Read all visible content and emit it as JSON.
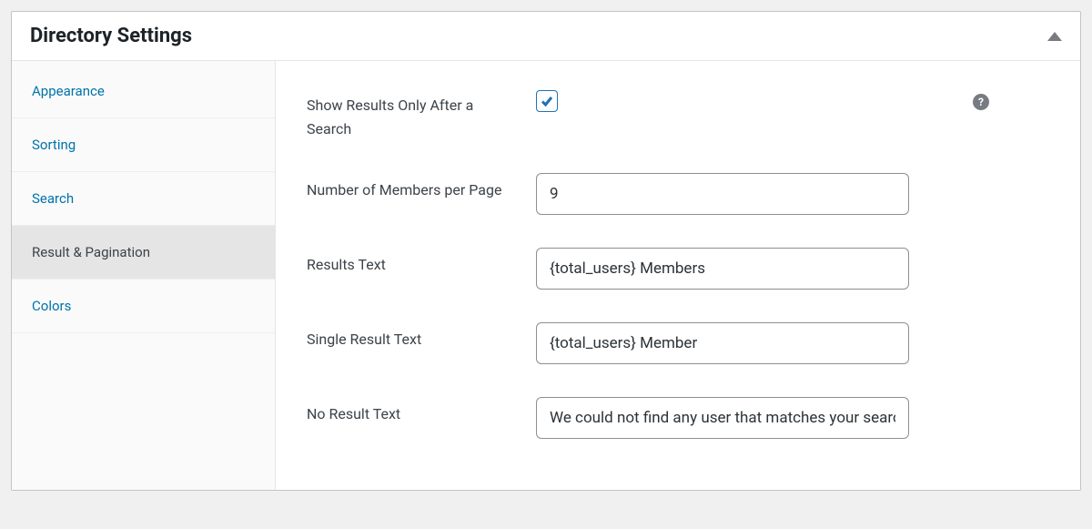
{
  "panel": {
    "title": "Directory Settings"
  },
  "sidebar": {
    "items": [
      {
        "label": "Appearance"
      },
      {
        "label": "Sorting"
      },
      {
        "label": "Search"
      },
      {
        "label": "Result & Pagination"
      },
      {
        "label": "Colors"
      }
    ],
    "active_index": 3
  },
  "form": {
    "show_results_after_search": {
      "label": "Show Results Only After a Search",
      "checked": true
    },
    "members_per_page": {
      "label": "Number of Members per Page",
      "value": "9"
    },
    "results_text": {
      "label": "Results Text",
      "value": "{total_users} Members"
    },
    "single_result_text": {
      "label": "Single Result Text",
      "value": "{total_users} Member"
    },
    "no_result_text": {
      "label": "No Result Text",
      "value": "We could not find any user that matches your search"
    }
  },
  "help_icon_char": "?"
}
